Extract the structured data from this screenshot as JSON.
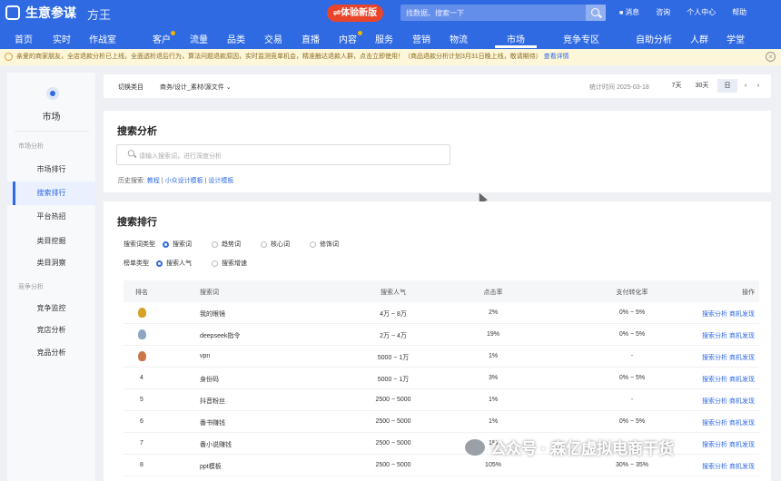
{
  "topbar": {
    "app_title": "生意参谋",
    "app_subtitle": "方王",
    "trial_label": "⇌体验新版",
    "search_placeholder": "找数据、搜索一下",
    "links": [
      "消息",
      "咨询",
      "个人中心",
      "帮助"
    ]
  },
  "nav": {
    "items": [
      "首页",
      "实时",
      "作战室",
      "客户",
      "流量",
      "品类",
      "交易",
      "直播",
      "内容",
      "服务",
      "营销",
      "物流",
      "市场",
      "竞争专区",
      "自助分析",
      "人群",
      "学堂"
    ],
    "active": "市场"
  },
  "notice": {
    "text": "亲爱的商家朋友，全店退款分析已上线，全面透析退后行为，算法问题退款原因，实时监测竞单机会，精准触达退款人群，点击立即使用！（商品退款分析计划3月31日晚上线，敬请期待）",
    "link": "查看详情"
  },
  "sidebar": {
    "title": "市场",
    "group1": "市场分析",
    "items1": [
      "市场排行",
      "搜索排行",
      "平台热招",
      "类目挖掘",
      "类目洞察"
    ],
    "group2": "竞争分析",
    "items2": [
      "竞争监控",
      "竞店分析",
      "竞品分析"
    ],
    "active": "搜索排行"
  },
  "filter": {
    "switch_label": "切换类目",
    "category": "商务/设计_素材/源文件",
    "stats_date": "统计时间 2025-03-18",
    "ranges": [
      "7天",
      "30天",
      "日"
    ]
  },
  "search_analysis": {
    "title": "搜索分析",
    "placeholder": "请输入搜索词，进行深度分析",
    "history_label": "历史搜索:",
    "history": [
      "教程",
      "小众设计模板",
      "设计模板"
    ]
  },
  "ranking": {
    "title": "搜索排行",
    "type_label": "搜索词类型",
    "types": [
      "搜索词",
      "趋势词",
      "核心词",
      "修饰词"
    ],
    "list_label": "榜单类型",
    "lists": [
      "搜索人气",
      "搜索增速"
    ],
    "headers": {
      "rank": "排名",
      "keyword": "搜索词",
      "popularity": "搜索人气",
      "ctr": "点击率",
      "pay_rate": "支付转化率",
      "ops": "操作"
    },
    "rows": [
      {
        "rank": "",
        "medal": "gold",
        "keyword": "我的眼镜",
        "popularity": "4万 ~ 8万",
        "ctr": "2%",
        "pay_rate": "0% ~ 5%",
        "ops": "搜索分析  商机发现"
      },
      {
        "rank": "",
        "medal": "silver",
        "keyword": "deepseek指令",
        "popularity": "2万 ~ 4万",
        "ctr": "19%",
        "pay_rate": "0% ~ 5%",
        "ops": "搜索分析  商机发现"
      },
      {
        "rank": "",
        "medal": "bronze",
        "keyword": "vpn",
        "popularity": "5000 ~ 1万",
        "ctr": "1%",
        "pay_rate": "-",
        "ops": "搜索分析  商机发现"
      },
      {
        "rank": "4",
        "medal": "",
        "keyword": "身份码",
        "popularity": "5000 ~ 1万",
        "ctr": "3%",
        "pay_rate": "0% ~ 5%",
        "ops": "搜索分析  商机发现"
      },
      {
        "rank": "5",
        "medal": "",
        "keyword": "抖音粉丝",
        "popularity": "2500 ~ 5000",
        "ctr": "1%",
        "pay_rate": "-",
        "ops": "搜索分析  商机发现"
      },
      {
        "rank": "6",
        "medal": "",
        "keyword": "番书赚钱",
        "popularity": "2500 ~ 5000",
        "ctr": "1%",
        "pay_rate": "0% ~ 5%",
        "ops": "搜索分析  商机发现"
      },
      {
        "rank": "7",
        "medal": "",
        "keyword": "番小说赚钱",
        "popularity": "2500 ~ 5000",
        "ctr": "1%",
        "pay_rate": "-",
        "ops": "搜索分析  商机发现"
      },
      {
        "rank": "8",
        "medal": "",
        "keyword": "ppt模板",
        "popularity": "2500 ~ 5000",
        "ctr": "105%",
        "pay_rate": "30% ~ 35%",
        "ops": "搜索分析  商机发现"
      }
    ]
  },
  "watermark": "公众号 · 森亿虚拟电商干货"
}
